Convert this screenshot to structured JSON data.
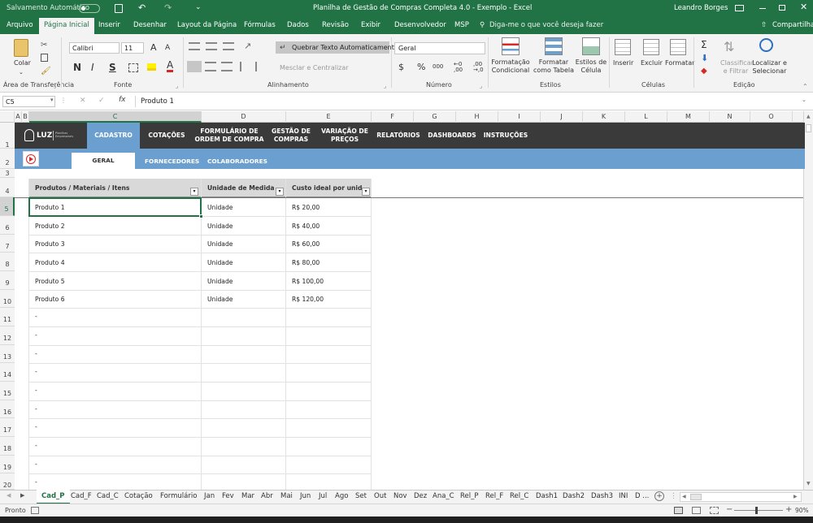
{
  "title_bar": {
    "autosave_label": "Salvamento Automático",
    "autosave_state": "Desativado",
    "document_title": "Planilha de Gestão de Compras Completa 4.0 - Exemplo  -  Excel",
    "user": "Leandro Borges"
  },
  "ribbon_tabs": [
    "Arquivo",
    "Página Inicial",
    "Inserir",
    "Desenhar",
    "Layout da Página",
    "Fórmulas",
    "Dados",
    "Revisão",
    "Exibir",
    "Desenvolvedor",
    "MSP"
  ],
  "active_tab": "Página Inicial",
  "tell_me": "Diga-me o que você deseja fazer",
  "share_label": "Compartilhar",
  "ribbon": {
    "clipboard": {
      "paste": "Colar",
      "group": "Área de Transferência"
    },
    "font": {
      "name": "Calibri",
      "size": "11",
      "bold": "N",
      "italic": "I",
      "underline": "S",
      "group": "Fonte"
    },
    "alignment": {
      "wrap": "Quebrar Texto Automaticamente",
      "merge": "Mesclar e Centralizar",
      "group": "Alinhamento"
    },
    "number": {
      "format": "Geral",
      "currency": "$",
      "percent": "%",
      "comma": "000",
      "group": "Número"
    },
    "styles": {
      "cond": "Formatação Condicional",
      "table": "Formatar como Tabela",
      "cell": "Estilos de Célula",
      "group": "Estilos"
    },
    "cells": {
      "insert": "Inserir",
      "delete": "Excluir",
      "format": "Formatar",
      "group": "Células"
    },
    "editing": {
      "sort": "Classificar e Filtrar",
      "find": "Localizar e Selecionar",
      "group": "Edição"
    }
  },
  "formula_bar": {
    "name_box": "C5",
    "fx": "fx",
    "content": "Produto 1"
  },
  "columns": [
    "A",
    "B",
    "C",
    "D",
    "E",
    "F",
    "G",
    "H",
    "I",
    "J",
    "K",
    "L",
    "M",
    "N",
    "O"
  ],
  "rows": [
    "1",
    "2",
    "3",
    "4",
    "5",
    "6",
    "7",
    "8",
    "9",
    "10",
    "11",
    "12",
    "13",
    "14",
    "15",
    "16",
    "17",
    "18",
    "19",
    "20"
  ],
  "nav_menu": [
    "CADASTRO",
    "COTAÇÕES",
    "FORMULÁRIO DE ORDEM DE COMPRA",
    "GESTÃO DE COMPRAS",
    "VARIAÇÃO DE PREÇOS",
    "RELATÓRIOS",
    "DASHBOARDS",
    "INSTRUÇÕES"
  ],
  "logo": {
    "text": "LUZ",
    "tagline": "Planilhas Empresariais"
  },
  "sub_tabs": [
    "GERAL",
    "FORNECEDORES",
    "COLABORADORES"
  ],
  "table": {
    "headers": [
      "Produtos / Materiais / Itens",
      "Unidade de Medida",
      "Custo ideal por unidade"
    ],
    "rows": [
      [
        "Produto 1",
        "Unidade",
        "R$ 20,00"
      ],
      [
        "Produto 2",
        "Unidade",
        "R$ 40,00"
      ],
      [
        "Produto 3",
        "Unidade",
        "R$ 60,00"
      ],
      [
        "Produto 4",
        "Unidade",
        "R$ 80,00"
      ],
      [
        "Produto 5",
        "Unidade",
        "R$ 100,00"
      ],
      [
        "Produto 6",
        "Unidade",
        "R$ 120,00"
      ]
    ],
    "empty_marker": "-"
  },
  "sheet_tabs": [
    "Cad_P",
    "Cad_F",
    "Cad_C",
    "Cotação",
    "Formulário",
    "Jan",
    "Fev",
    "Mar",
    "Abr",
    "Mai",
    "Jun",
    "Jul",
    "Ago",
    "Set",
    "Out",
    "Nov",
    "Dez",
    "Ana_C",
    "Rel_P",
    "Rel_F",
    "Rel_C",
    "Dash1",
    "Dash2",
    "Dash3",
    "INI",
    "D ..."
  ],
  "active_sheet": "Cad_P",
  "status": {
    "ready": "Pronto",
    "zoom": "90%"
  },
  "colors": {
    "excel_green": "#217346",
    "nav_dark": "#3a3a3a",
    "sub_blue": "#6a9fd0",
    "brand_red": "#d62828"
  }
}
